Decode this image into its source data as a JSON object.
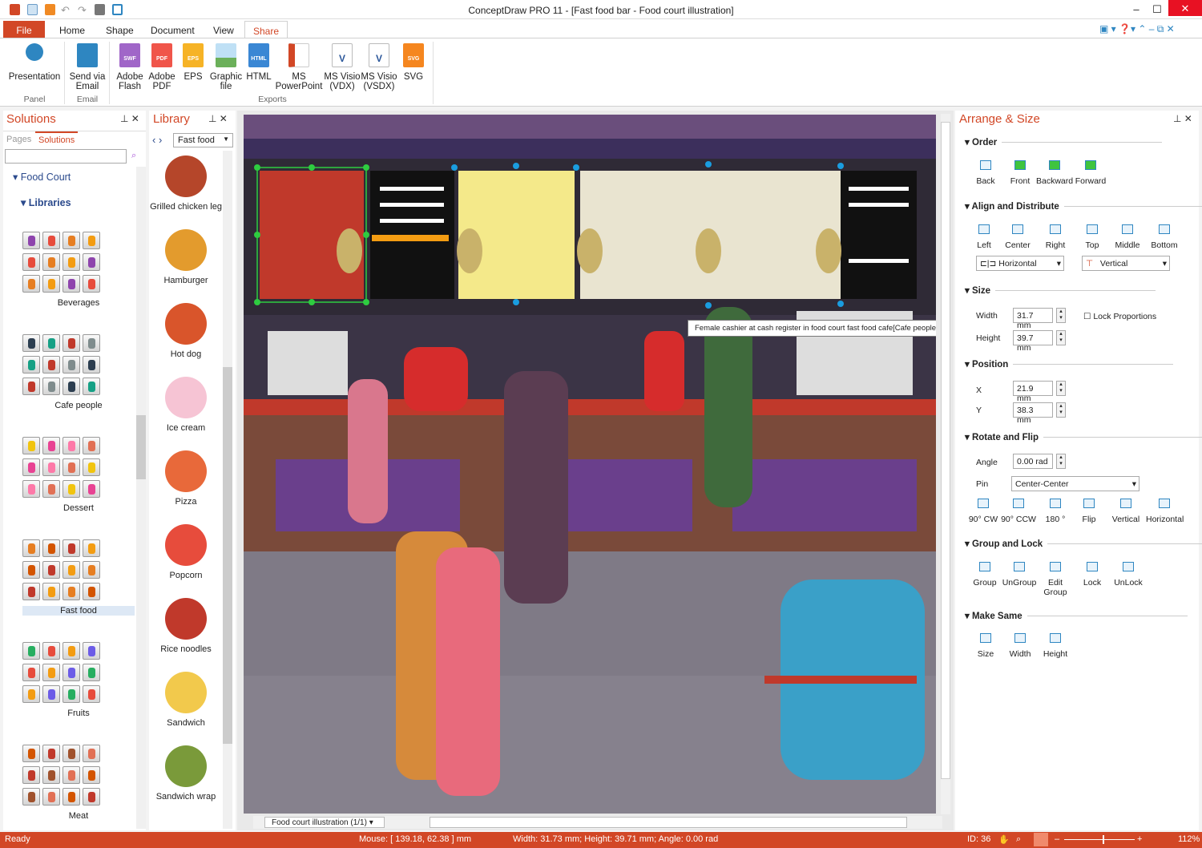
{
  "window": {
    "title": "ConceptDraw PRO 11 - [Fast food bar - Food court illustration]"
  },
  "tabs": [
    "File",
    "Home",
    "Shape",
    "Document",
    "View",
    "Share"
  ],
  "ribbon": {
    "buttons": [
      {
        "label": "Presentation",
        "icon": "presentation-icon",
        "color": "#2e86c1"
      },
      {
        "label": "Send via Email",
        "icon": "email-icon",
        "color": "#2e86c1"
      },
      {
        "label": "Adobe Flash",
        "icon": "swf-icon",
        "color": "#a066c8",
        "tag": "SWF"
      },
      {
        "label": "Adobe PDF",
        "icon": "pdf-icon",
        "color": "#f0554a",
        "tag": "PDF"
      },
      {
        "label": "EPS",
        "icon": "eps-icon",
        "color": "#f6b326",
        "tag": "EPS"
      },
      {
        "label": "Graphic file",
        "icon": "image-icon",
        "color": "#7ab8e0"
      },
      {
        "label": "HTML",
        "icon": "html-icon",
        "color": "#3a87d4",
        "tag": "HTML"
      },
      {
        "label": "MS PowerPoint",
        "icon": "powerpoint-icon",
        "color": "#d24726"
      },
      {
        "label": "MS Visio (VDX)",
        "icon": "visio-icon",
        "color": "#2b579a",
        "tag": "V"
      },
      {
        "label": "MS Visio (VSDX)",
        "icon": "visio-icon",
        "color": "#2b579a",
        "tag": "V"
      },
      {
        "label": "SVG",
        "icon": "svg-icon",
        "color": "#f5861f",
        "tag": "SVG"
      }
    ],
    "groups": [
      "Panel",
      "Email",
      "Exports"
    ]
  },
  "solutions": {
    "title": "Solutions",
    "tabs": [
      "Pages",
      "Solutions"
    ],
    "search_placeholder": "",
    "tree_root": "Food Court",
    "tree_child": "Libraries",
    "libraries": [
      "Beverages",
      "Cafe people",
      "Dessert",
      "Fast food",
      "Fruits",
      "Meat"
    ]
  },
  "library": {
    "title": "Library",
    "dropdown": "Fast food",
    "items": [
      "Grilled chicken leg",
      "Hamburger",
      "Hot dog",
      "Ice cream",
      "Pizza",
      "Popcorn",
      "Rice noodles",
      "Sandwich",
      "Sandwich wrap"
    ]
  },
  "canvas": {
    "tooltip": "Female cashier at cash register in food court fast food cafe[Cafe people.cdl]",
    "page_tab": "Food court illustration (1/1)"
  },
  "arrange": {
    "title": "Arrange & Size",
    "order": {
      "title": "Order",
      "buttons": [
        "Back",
        "Front",
        "Backward",
        "Forward"
      ]
    },
    "align": {
      "title": "Align and Distribute",
      "buttons": [
        "Left",
        "Center",
        "Right",
        "Top",
        "Middle",
        "Bottom"
      ],
      "horizontal": "Horizontal",
      "vertical": "Vertical"
    },
    "size": {
      "title": "Size",
      "width_label": "Width",
      "width": "31.7 mm",
      "height_label": "Height",
      "height": "39.7 mm",
      "lock": "Lock Proportions"
    },
    "position": {
      "title": "Position",
      "x_label": "X",
      "x": "21.9 mm",
      "y_label": "Y",
      "y": "38.3 mm"
    },
    "rotate": {
      "title": "Rotate and Flip",
      "angle_label": "Angle",
      "angle": "0.00 rad",
      "pin_label": "Pin",
      "pin": "Center-Center",
      "buttons": [
        "90° CW",
        "90° CCW",
        "180 °",
        "Flip",
        "Vertical",
        "Horizontal"
      ]
    },
    "group": {
      "title": "Group and Lock",
      "buttons": [
        "Group",
        "UnGroup",
        "Edit Group",
        "Lock",
        "UnLock"
      ]
    },
    "same": {
      "title": "Make Same",
      "buttons": [
        "Size",
        "Width",
        "Height"
      ]
    }
  },
  "status": {
    "ready": "Ready",
    "mouse": "Mouse: [ 139.18, 62.38 ] mm",
    "dims": "Width: 31.73 mm;  Height: 39.71 mm;  Angle: 0.00 rad",
    "id": "ID: 36",
    "zoom": "112%",
    "zoom_fraction": 0.55
  },
  "colors": {
    "accent": "#d24726"
  }
}
